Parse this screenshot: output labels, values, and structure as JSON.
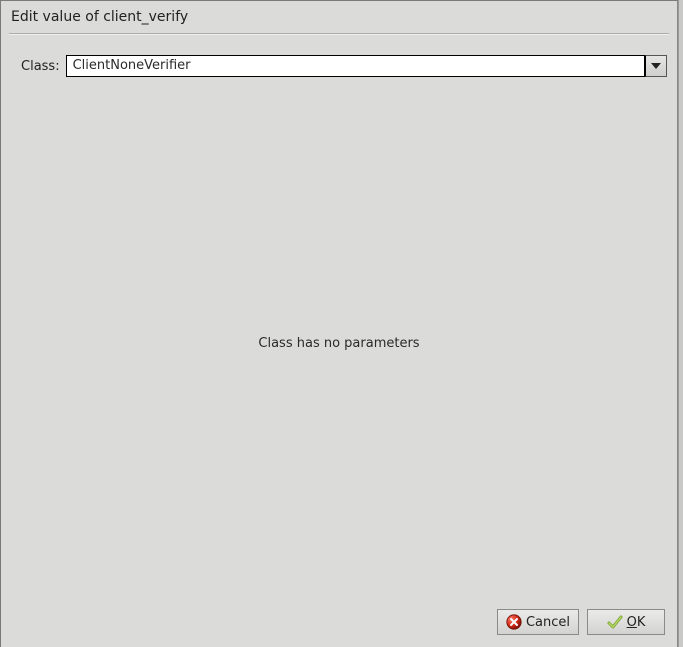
{
  "dialog": {
    "title": "Edit value of client_verify"
  },
  "form": {
    "class_label": "Class:",
    "class_value": "ClientNoneVerifier"
  },
  "body": {
    "message": "Class has no parameters"
  },
  "buttons": {
    "cancel_label": "Cancel",
    "ok_prefix": "O",
    "ok_rest": "K"
  }
}
